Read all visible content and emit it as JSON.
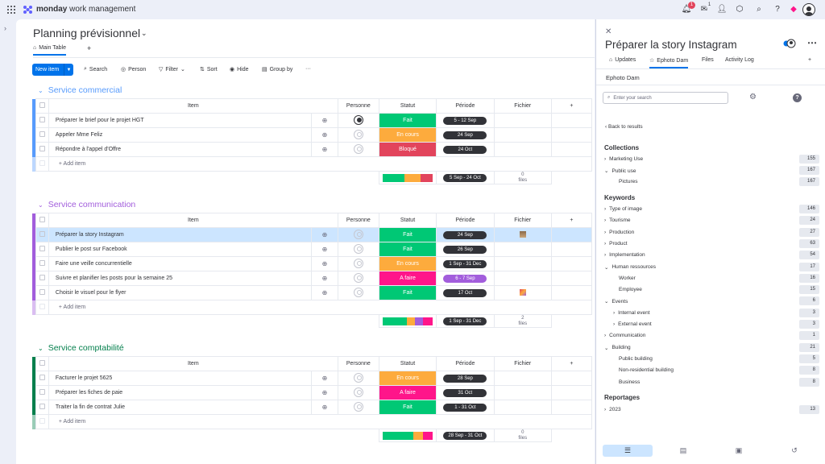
{
  "brand": {
    "bold": "monday",
    "rest": " work management"
  },
  "topbar": {
    "notif_count": "1",
    "inbox_count": "1"
  },
  "board": {
    "title": "Planning prévisionnel",
    "tab_main": "Main Table",
    "tab_plus": "+",
    "toolbar": {
      "new_item": "New item",
      "search": "Search",
      "person": "Person",
      "filter": "Filter",
      "sort": "Sort",
      "hide": "Hide",
      "group_by": "Group by",
      "more": "···"
    }
  },
  "columns": {
    "item": "Item",
    "person": "Personne",
    "status": "Statut",
    "period": "Période",
    "file": "Fichier",
    "add": "+"
  },
  "add_item": "+ Add item",
  "groups": [
    {
      "title": "Service commercial",
      "color": "#579bfc",
      "rows": [
        {
          "name": "Préparer le brief pour le projet HGT",
          "status": "Fait",
          "status_color": "#00c875",
          "period": "5 - 12 Sep"
        },
        {
          "name": "Appeler Mme Feliz",
          "status": "En cours",
          "status_color": "#fdab3d",
          "period": "24 Sep"
        },
        {
          "name": "Répondre à l'appel d'Offre",
          "status": "Bloqué",
          "status_color": "#e2445c",
          "period": "24 Oct"
        }
      ],
      "summary": {
        "period": "5 Sep - 24 Oct",
        "files_count": "0",
        "files_label": "files"
      }
    },
    {
      "title": "Service communication",
      "color": "#a25ddc",
      "rows": [
        {
          "name": "Préparer la story Instagram",
          "status": "Fait",
          "status_color": "#00c875",
          "period": "24 Sep"
        },
        {
          "name": "Publier le post sur Facebook",
          "status": "Fait",
          "status_color": "#00c875",
          "period": "26 Sep"
        },
        {
          "name": "Faire une veille concurrentielle",
          "status": "En cours",
          "status_color": "#fdab3d",
          "period": "1 Sep - 31 Dec"
        },
        {
          "name": "Suivre et planifier les posts pour la semaine 25",
          "status": "A faire",
          "status_color": "#ff158a",
          "period": "6 - 7 Sep"
        },
        {
          "name": "Choisir le visuel pour le flyer",
          "status": "Fait",
          "status_color": "#00c875",
          "period": "17 Oct"
        }
      ],
      "summary": {
        "period": "1 Sep - 31 Dec",
        "files_count": "2",
        "files_label": "files"
      }
    },
    {
      "title": "Service comptabilité",
      "color": "#037f4c",
      "rows": [
        {
          "name": "Facturer le projet 5625",
          "status": "En cours",
          "status_color": "#fdab3d",
          "period": "28 Sep"
        },
        {
          "name": "Préparer les fiches de paie",
          "status": "A faire",
          "status_color": "#ff158a",
          "period": "31 Oct"
        },
        {
          "name": "Traiter la fin de contrat Julie",
          "status": "Fait",
          "status_color": "#00c875",
          "period": "1 - 31 Oct"
        }
      ],
      "summary": {
        "period": "28 Sep - 31 Oct",
        "files_count": "0",
        "files_label": "files"
      }
    }
  ],
  "panel": {
    "close": "✕",
    "title": "Préparer la story Instagram",
    "tabs": {
      "updates": "Updates",
      "ephoto": "Ephoto Dam",
      "files": "Files",
      "activity": "Activity Log",
      "plus": "+"
    },
    "subtitle": "Ephoto Dam",
    "search_placeholder": "Enter your search",
    "help": "?",
    "back": "Back to results",
    "collections_title": "Collections",
    "collections": [
      {
        "label": "Marketing Use",
        "count": "155",
        "indent": 0,
        "chev": "›"
      },
      {
        "label": "Public use",
        "count": "167",
        "indent": 0,
        "chev": "⌄"
      },
      {
        "label": "Pictures",
        "count": "167",
        "indent": 1,
        "chev": ""
      }
    ],
    "keywords_title": "Keywords",
    "keywords": [
      {
        "label": "Type of image",
        "count": "146",
        "indent": 0,
        "chev": "›"
      },
      {
        "label": "Tourisme",
        "count": "24",
        "indent": 0,
        "chev": "›"
      },
      {
        "label": "Production",
        "count": "27",
        "indent": 0,
        "chev": "›"
      },
      {
        "label": "Product",
        "count": "63",
        "indent": 0,
        "chev": "›"
      },
      {
        "label": "Implementation",
        "count": "54",
        "indent": 0,
        "chev": "›"
      },
      {
        "label": "Human ressources",
        "count": "17",
        "indent": 0,
        "chev": "⌄"
      },
      {
        "label": "Worker",
        "count": "16",
        "indent": 1,
        "chev": ""
      },
      {
        "label": "Employee",
        "count": "15",
        "indent": 1,
        "chev": ""
      },
      {
        "label": "Events",
        "count": "6",
        "indent": 0,
        "chev": "⌄"
      },
      {
        "label": "Internal event",
        "count": "3",
        "indent": 1,
        "chev": "›"
      },
      {
        "label": "External event",
        "count": "3",
        "indent": 1,
        "chev": "›"
      },
      {
        "label": "Communication",
        "count": "1",
        "indent": 0,
        "chev": "›"
      },
      {
        "label": "Building",
        "count": "21",
        "indent": 0,
        "chev": "⌄"
      },
      {
        "label": "Public building",
        "count": "5",
        "indent": 1,
        "chev": ""
      },
      {
        "label": "Non-residential building",
        "count": "8",
        "indent": 1,
        "chev": ""
      },
      {
        "label": "Business",
        "count": "8",
        "indent": 1,
        "chev": ""
      }
    ],
    "reportages_title": "Reportages",
    "reportages": [
      {
        "label": "2023",
        "count": "13",
        "indent": 0,
        "chev": "›"
      }
    ]
  }
}
